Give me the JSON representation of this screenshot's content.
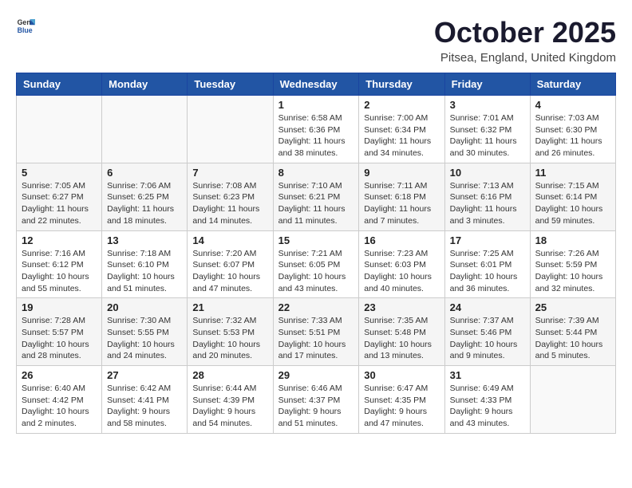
{
  "header": {
    "logo_general": "General",
    "logo_blue": "Blue",
    "month": "October 2025",
    "location": "Pitsea, England, United Kingdom"
  },
  "weekdays": [
    "Sunday",
    "Monday",
    "Tuesday",
    "Wednesday",
    "Thursday",
    "Friday",
    "Saturday"
  ],
  "weeks": [
    [
      {
        "day": "",
        "info": ""
      },
      {
        "day": "",
        "info": ""
      },
      {
        "day": "",
        "info": ""
      },
      {
        "day": "1",
        "info": "Sunrise: 6:58 AM\nSunset: 6:36 PM\nDaylight: 11 hours\nand 38 minutes."
      },
      {
        "day": "2",
        "info": "Sunrise: 7:00 AM\nSunset: 6:34 PM\nDaylight: 11 hours\nand 34 minutes."
      },
      {
        "day": "3",
        "info": "Sunrise: 7:01 AM\nSunset: 6:32 PM\nDaylight: 11 hours\nand 30 minutes."
      },
      {
        "day": "4",
        "info": "Sunrise: 7:03 AM\nSunset: 6:30 PM\nDaylight: 11 hours\nand 26 minutes."
      }
    ],
    [
      {
        "day": "5",
        "info": "Sunrise: 7:05 AM\nSunset: 6:27 PM\nDaylight: 11 hours\nand 22 minutes."
      },
      {
        "day": "6",
        "info": "Sunrise: 7:06 AM\nSunset: 6:25 PM\nDaylight: 11 hours\nand 18 minutes."
      },
      {
        "day": "7",
        "info": "Sunrise: 7:08 AM\nSunset: 6:23 PM\nDaylight: 11 hours\nand 14 minutes."
      },
      {
        "day": "8",
        "info": "Sunrise: 7:10 AM\nSunset: 6:21 PM\nDaylight: 11 hours\nand 11 minutes."
      },
      {
        "day": "9",
        "info": "Sunrise: 7:11 AM\nSunset: 6:18 PM\nDaylight: 11 hours\nand 7 minutes."
      },
      {
        "day": "10",
        "info": "Sunrise: 7:13 AM\nSunset: 6:16 PM\nDaylight: 11 hours\nand 3 minutes."
      },
      {
        "day": "11",
        "info": "Sunrise: 7:15 AM\nSunset: 6:14 PM\nDaylight: 10 hours\nand 59 minutes."
      }
    ],
    [
      {
        "day": "12",
        "info": "Sunrise: 7:16 AM\nSunset: 6:12 PM\nDaylight: 10 hours\nand 55 minutes."
      },
      {
        "day": "13",
        "info": "Sunrise: 7:18 AM\nSunset: 6:10 PM\nDaylight: 10 hours\nand 51 minutes."
      },
      {
        "day": "14",
        "info": "Sunrise: 7:20 AM\nSunset: 6:07 PM\nDaylight: 10 hours\nand 47 minutes."
      },
      {
        "day": "15",
        "info": "Sunrise: 7:21 AM\nSunset: 6:05 PM\nDaylight: 10 hours\nand 43 minutes."
      },
      {
        "day": "16",
        "info": "Sunrise: 7:23 AM\nSunset: 6:03 PM\nDaylight: 10 hours\nand 40 minutes."
      },
      {
        "day": "17",
        "info": "Sunrise: 7:25 AM\nSunset: 6:01 PM\nDaylight: 10 hours\nand 36 minutes."
      },
      {
        "day": "18",
        "info": "Sunrise: 7:26 AM\nSunset: 5:59 PM\nDaylight: 10 hours\nand 32 minutes."
      }
    ],
    [
      {
        "day": "19",
        "info": "Sunrise: 7:28 AM\nSunset: 5:57 PM\nDaylight: 10 hours\nand 28 minutes."
      },
      {
        "day": "20",
        "info": "Sunrise: 7:30 AM\nSunset: 5:55 PM\nDaylight: 10 hours\nand 24 minutes."
      },
      {
        "day": "21",
        "info": "Sunrise: 7:32 AM\nSunset: 5:53 PM\nDaylight: 10 hours\nand 20 minutes."
      },
      {
        "day": "22",
        "info": "Sunrise: 7:33 AM\nSunset: 5:51 PM\nDaylight: 10 hours\nand 17 minutes."
      },
      {
        "day": "23",
        "info": "Sunrise: 7:35 AM\nSunset: 5:48 PM\nDaylight: 10 hours\nand 13 minutes."
      },
      {
        "day": "24",
        "info": "Sunrise: 7:37 AM\nSunset: 5:46 PM\nDaylight: 10 hours\nand 9 minutes."
      },
      {
        "day": "25",
        "info": "Sunrise: 7:39 AM\nSunset: 5:44 PM\nDaylight: 10 hours\nand 5 minutes."
      }
    ],
    [
      {
        "day": "26",
        "info": "Sunrise: 6:40 AM\nSunset: 4:42 PM\nDaylight: 10 hours\nand 2 minutes."
      },
      {
        "day": "27",
        "info": "Sunrise: 6:42 AM\nSunset: 4:41 PM\nDaylight: 9 hours\nand 58 minutes."
      },
      {
        "day": "28",
        "info": "Sunrise: 6:44 AM\nSunset: 4:39 PM\nDaylight: 9 hours\nand 54 minutes."
      },
      {
        "day": "29",
        "info": "Sunrise: 6:46 AM\nSunset: 4:37 PM\nDaylight: 9 hours\nand 51 minutes."
      },
      {
        "day": "30",
        "info": "Sunrise: 6:47 AM\nSunset: 4:35 PM\nDaylight: 9 hours\nand 47 minutes."
      },
      {
        "day": "31",
        "info": "Sunrise: 6:49 AM\nSunset: 4:33 PM\nDaylight: 9 hours\nand 43 minutes."
      },
      {
        "day": "",
        "info": ""
      }
    ]
  ]
}
